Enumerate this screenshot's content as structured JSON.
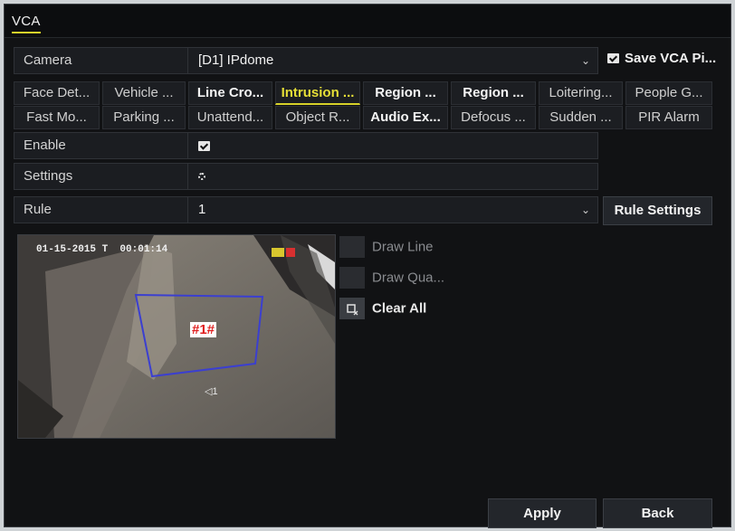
{
  "header": {
    "tab_label": "VCA"
  },
  "camera": {
    "label": "Camera",
    "value": "[D1] IPdome",
    "save_label": "Save VCA Pi..."
  },
  "event_tabs_row1": [
    {
      "label": "Face Det...",
      "style": "normal"
    },
    {
      "label": "Vehicle ...",
      "style": "normal"
    },
    {
      "label": "Line Cro...",
      "style": "bold"
    },
    {
      "label": "Intrusion ...",
      "style": "active"
    },
    {
      "label": "Region ...",
      "style": "bold"
    },
    {
      "label": "Region ...",
      "style": "bold"
    },
    {
      "label": "Loitering...",
      "style": "normal"
    },
    {
      "label": "People G...",
      "style": "normal"
    }
  ],
  "event_tabs_row2": [
    {
      "label": "Fast Mo...",
      "style": "normal"
    },
    {
      "label": "Parking ...",
      "style": "normal"
    },
    {
      "label": "Unattend...",
      "style": "normal"
    },
    {
      "label": "Object R...",
      "style": "normal"
    },
    {
      "label": "Audio Ex...",
      "style": "bold"
    },
    {
      "label": "Defocus ...",
      "style": "normal"
    },
    {
      "label": "Sudden ...",
      "style": "normal"
    },
    {
      "label": "PIR Alarm",
      "style": "normal"
    }
  ],
  "enable": {
    "label": "Enable",
    "checked": true
  },
  "settings": {
    "label": "Settings",
    "icon": "gear-icon"
  },
  "rule": {
    "label": "Rule",
    "value": "1",
    "settings_button": "Rule Settings"
  },
  "video": {
    "timestamp": "01-15-2015 T",
    "time": "00:01:14",
    "region_label": "#1#",
    "marker_label": "1"
  },
  "tools": {
    "draw_line": "Draw Line",
    "draw_quad": "Draw Qua...",
    "clear_all": "Clear All"
  },
  "footer": {
    "apply": "Apply",
    "back": "Back"
  },
  "colors": {
    "accent": "#d8d22a",
    "background": "#111214",
    "region_outline": "#3b3fd0",
    "region_label": "#e02020"
  }
}
